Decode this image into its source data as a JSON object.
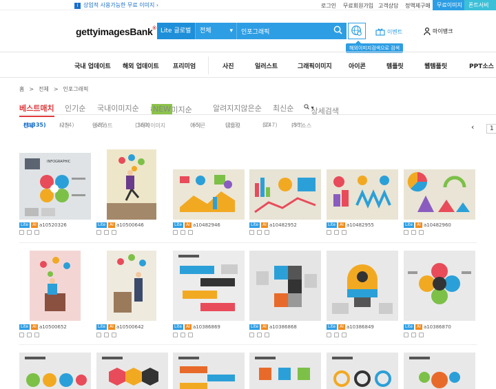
{
  "topbar": {
    "notice": "상업적 사용가능한 무료 이미지",
    "links": [
      "로그인",
      "무료회원가입",
      "고객상담",
      "정액제구매"
    ],
    "free_image_btn": "무료이미지",
    "fonts_btn": "폰트서비스",
    "colors": {
      "free": "#2e9ee4",
      "fonts": "#3cc0d8"
    }
  },
  "header": {
    "logo_text": "gettyimagesBank",
    "logo_sup": "®",
    "search": {
      "scope": "Lite 글로벌",
      "category": "전체",
      "query": "인포그래픽"
    },
    "tooltip": "해외이미지검색으로 검색",
    "event": "이벤트",
    "mybank": "마이뱅크"
  },
  "nav": {
    "items": [
      "국내 업데이트",
      "해외 업데이트",
      "프리미엄",
      "사진",
      "일러스트",
      "그래픽이미지",
      "아이콘",
      "템플릿",
      "웹템플릿",
      "PPT소스"
    ]
  },
  "breadcrumb": {
    "home": "홈",
    "items": [
      "전체",
      "인포그래픽"
    ],
    "sep": ">"
  },
  "sort_tabs": [
    "베스트매치",
    "인기순",
    "국내이미지순",
    "해외이미지순",
    "알려지지않은순",
    "최신순"
  ],
  "new_tag": "NEW",
  "advanced_search": "상세검색",
  "categories": [
    {
      "label": "전체",
      "count": "(1,335)"
    },
    {
      "label": "사진",
      "count": "(254)"
    },
    {
      "label": "일러스트",
      "count": "(685)"
    },
    {
      "label": "그래픽이미지",
      "count": "(360)"
    },
    {
      "label": "아이콘",
      "count": "(65)"
    },
    {
      "label": "템플릿",
      "count": "(203)"
    },
    {
      "label": "3D",
      "count": "(247)"
    },
    {
      "label": "PPT소스",
      "count": "(53)"
    }
  ],
  "pager": {
    "prev": "‹",
    "page": "1"
  },
  "badges": {
    "lite": "Lite",
    "ai": "AI"
  },
  "row1": [
    "a10520326",
    "a10500646",
    "a10482946",
    "a10482952",
    "a10482955",
    "a10482960"
  ],
  "row2": [
    "a10500652",
    "a10500642",
    "a10386869",
    "a10386868",
    "a10386849",
    "a10386870"
  ]
}
